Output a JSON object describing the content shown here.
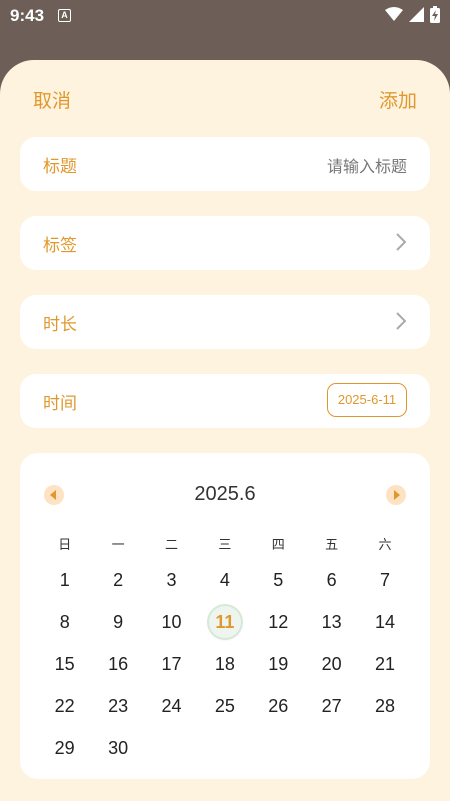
{
  "status_bar": {
    "time": "9:43",
    "notif_icon_letter": "A",
    "icons": [
      "wifi-icon",
      "signal-icon",
      "battery-charging-icon"
    ]
  },
  "header": {
    "cancel_label": "取消",
    "add_label": "添加"
  },
  "fields": {
    "title": {
      "label": "标题",
      "placeholder": "请输入标题"
    },
    "tag": {
      "label": "标签"
    },
    "duration": {
      "label": "时长"
    },
    "time": {
      "label": "时间",
      "value": "2025-6-11"
    }
  },
  "calendar": {
    "month_title": "2025.6",
    "weekdays": [
      "日",
      "一",
      "二",
      "三",
      "四",
      "五",
      "六"
    ],
    "days": [
      "1",
      "2",
      "3",
      "4",
      "5",
      "6",
      "7",
      "8",
      "9",
      "10",
      "11",
      "12",
      "13",
      "14",
      "15",
      "16",
      "17",
      "18",
      "19",
      "20",
      "21",
      "22",
      "23",
      "24",
      "25",
      "26",
      "27",
      "28",
      "29",
      "30"
    ],
    "first_weekday_index": 0,
    "selected_day": "11"
  },
  "colors": {
    "accent": "#e0982e",
    "sheet_background": "#fef3df",
    "card_background": "#ffffff"
  }
}
